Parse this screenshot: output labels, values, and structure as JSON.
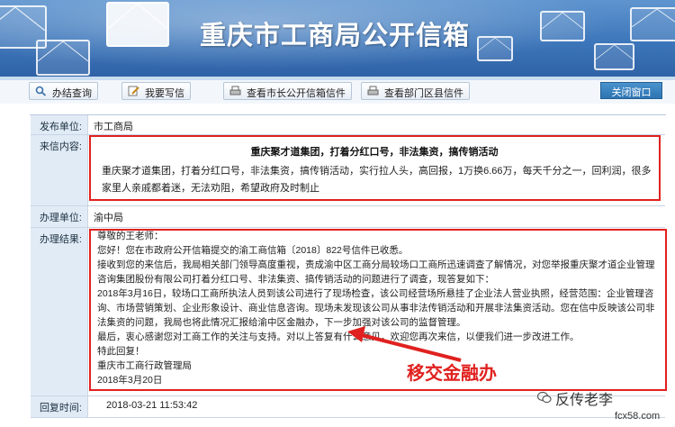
{
  "banner": {
    "title": "重庆市工商局公开信箱"
  },
  "toolbar": {
    "btn_query": "办结查询",
    "btn_write": "我要写信",
    "btn_mayor": "查看市长公开信箱信件",
    "btn_dept": "查看部门区县信件",
    "btn_close": "关闭窗口"
  },
  "form": {
    "publisher_label": "发布单位:",
    "publisher_value": "市工商局",
    "content_label": "来信内容:",
    "letter_title": "重庆聚才道集团，打着分红口号，非法集资，搞传销活动",
    "letter_body": "重庆聚才道集团，打着分红口号，非法集资，搞传销活动，实行拉人头，高回报，1万换6.66万，每天千分之一，回利润，很多家里人亲戚都着迷，无法劝阻，希望政府及时制止",
    "handler_label": "办理单位:",
    "handler_value": "渝中局",
    "result_label": "办理结果:",
    "reply_lines": [
      "尊敬的王老师：",
      "您好！您在市政府公开信箱提交的渝工商信箱〔2018〕822号信件已收悉。",
      "接收到您的来信后，我局相关部门领导高度重视，责成渝中区工商分局较场口工商所迅速调查了解情况，对您举报重庆聚才道企业管理咨询集团股份有限公司打着分红口号、非法集资、搞传销活动的问题进行了调查，现答复如下：",
      "2018年3月16日，较场口工商所执法人员到该公司进行了现场检查，该公司经营场所悬挂了企业法人营业执照，经营范围：企业管理咨询、市场营销策划、企业形象设计、商业信息咨询。现场未发现该公司从事非法传销活动和开展非法集资活动。您在信中反映该公司非法集资的问题，我局也将此情况汇报给渝中区金融办，下一步加强对该公司的监督管理。",
      "最后，衷心感谢您对工商工作的关注与支持。对以上答复有什么意见，欢迎您再次来信，以便我们进一步改进工作。",
      "特此回复！",
      "重庆市工商行政管理局",
      "2018年3月20日"
    ],
    "reply_time_label": "回复时间:",
    "reply_time_value": "2018-03-21 11:53:42"
  },
  "annotation": {
    "text": "移交金融办"
  },
  "watermark": {
    "name": "反传老李",
    "site": "fcx58.com"
  },
  "colors": {
    "highlight_red": "#e0211f",
    "banner_blue": "#3d76ba",
    "label_bg": "#e1ebf6"
  }
}
